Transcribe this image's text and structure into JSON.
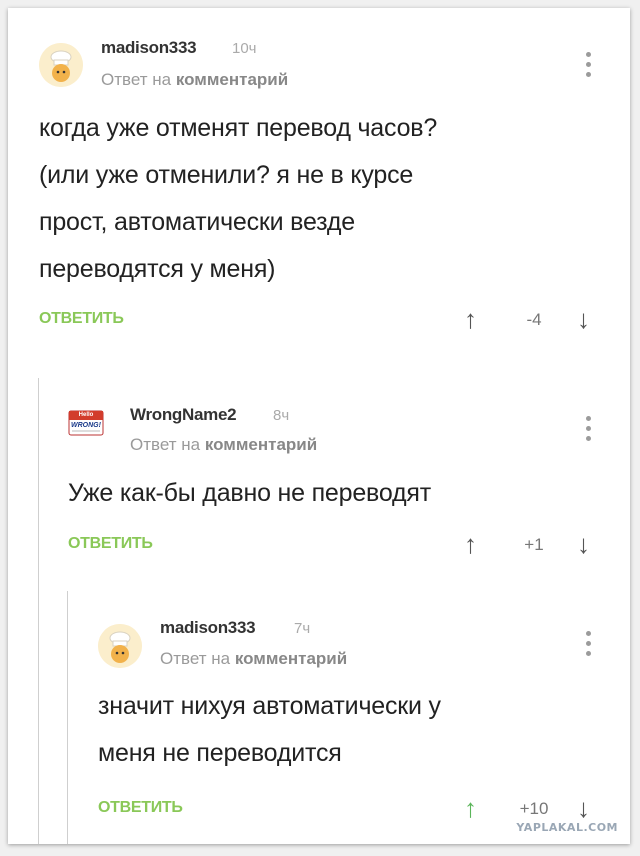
{
  "comments": [
    {
      "author": "madison333",
      "time": "10ч",
      "reply_prefix": "Ответ на",
      "reply_target": "комментарий",
      "text_lines": [
        "когда уже отменят перевод часов?",
        "(или уже отменили? я не в курсе",
        "прост, автоматически везде",
        "переводятся у меня)"
      ],
      "reply_label": "ОТВЕТИТЬ",
      "score": "-4"
    },
    {
      "author": "WrongName2",
      "time": "8ч",
      "reply_prefix": "Ответ на",
      "reply_target": "комментарий",
      "text_lines": [
        "Уже как-бы давно не переводят"
      ],
      "reply_label": "ОТВЕТИТЬ",
      "score": "+1",
      "avatar_text_top": "Hello",
      "avatar_text_main": "WRONG!"
    },
    {
      "author": "madison333",
      "time": "7ч",
      "reply_prefix": "Ответ на",
      "reply_target": "комментарий",
      "text_lines": [
        "значит нихуя автоматически у",
        "меня не переводится"
      ],
      "reply_label": "ОТВЕТИТЬ",
      "score": "+10"
    }
  ],
  "icons": {
    "up": "arrow-up-icon",
    "down": "arrow-down-icon",
    "menu": "more-vertical-icon"
  },
  "colors": {
    "reply": "#8ac858",
    "upvote_active": "#5bb55a"
  },
  "watermark": "YAPLAKAL.COM"
}
